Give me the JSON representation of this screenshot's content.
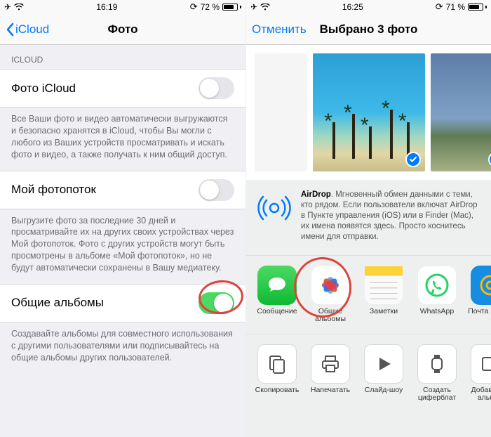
{
  "left": {
    "status": {
      "time": "16:19",
      "battery_pct": "72 %",
      "battery_fill": 72
    },
    "nav": {
      "back": "iCloud",
      "title": "Фото"
    },
    "section_header": "ICLOUD",
    "rows": {
      "photo_icloud": {
        "label": "Фото iCloud",
        "footer": "Все Ваши фото и видео автоматически выгружаются и безопасно хранятся в iCloud, чтобы Вы могли с любого из Ваших устройств просматривать и искать фото и видео, а также получать к ним общий доступ."
      },
      "photostream": {
        "label": "Мой фотопоток",
        "footer": "Выгрузите фото за последние 30 дней и просматривайте их на других своих устройствах через Мой фотопоток. Фото с других устройств могут быть просмотрены в альбоме «Мой фотопоток», но не будут автоматически сохранены в Вашу медиатеку."
      },
      "shared_albums": {
        "label": "Общие альбомы",
        "footer": "Создавайте альбомы для совместного использования с другими пользователями или подписывайтесь на общие альбомы других пользователей."
      }
    }
  },
  "right": {
    "status": {
      "time": "16:25",
      "battery_pct": "71 %",
      "battery_fill": 71
    },
    "nav": {
      "cancel": "Отменить",
      "title": "Выбрано 3 фото"
    },
    "airdrop": {
      "bold": "AirDrop",
      "text": ". Мгновенный обмен данными с теми, кто рядом. Если пользователи включат AirDrop в Пункте управления (iOS) или в Finder (Mac), их имена появятся здесь. Просто коснитесь имени для отправки."
    },
    "apps": {
      "imessage": "Сообщение",
      "shared_albums": "Общие альбомы",
      "notes": "Заметки",
      "whatsapp": "WhatsApp",
      "mailru": "Почта Mail.ru"
    },
    "actions": {
      "copy": "Скопировать",
      "print": "Напечатать",
      "slideshow": "Слайд-шоу",
      "watchface": "Создать циферблат",
      "add_album": "Добавить в альбом"
    }
  }
}
